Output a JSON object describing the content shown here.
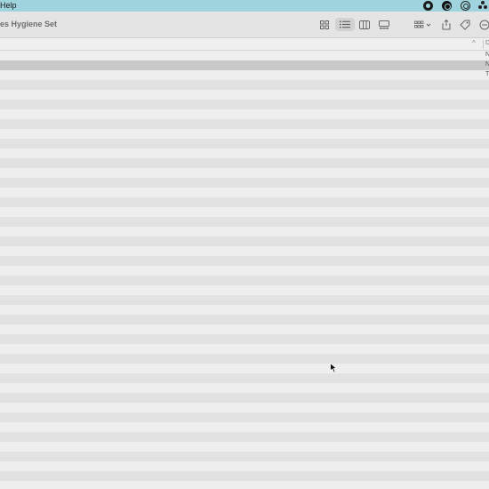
{
  "menubar": {
    "help_label": "Help",
    "status_icons": [
      "record-icon",
      "grammarly-icon",
      "chrome-icon",
      "creative-cloud-icon"
    ],
    "background_color": "#9fd4de"
  },
  "toolbar": {
    "window_title": "es Hygiene Set",
    "view_buttons": [
      "icon-view",
      "list-view",
      "column-view",
      "gallery-view"
    ],
    "active_view": "list-view"
  },
  "column_header": {
    "sort_indicator": "^",
    "visible_column_label": "D"
  },
  "rows": {
    "total": 45,
    "selected_index": 1,
    "visible_cells": [
      "N",
      "N",
      "T"
    ]
  }
}
